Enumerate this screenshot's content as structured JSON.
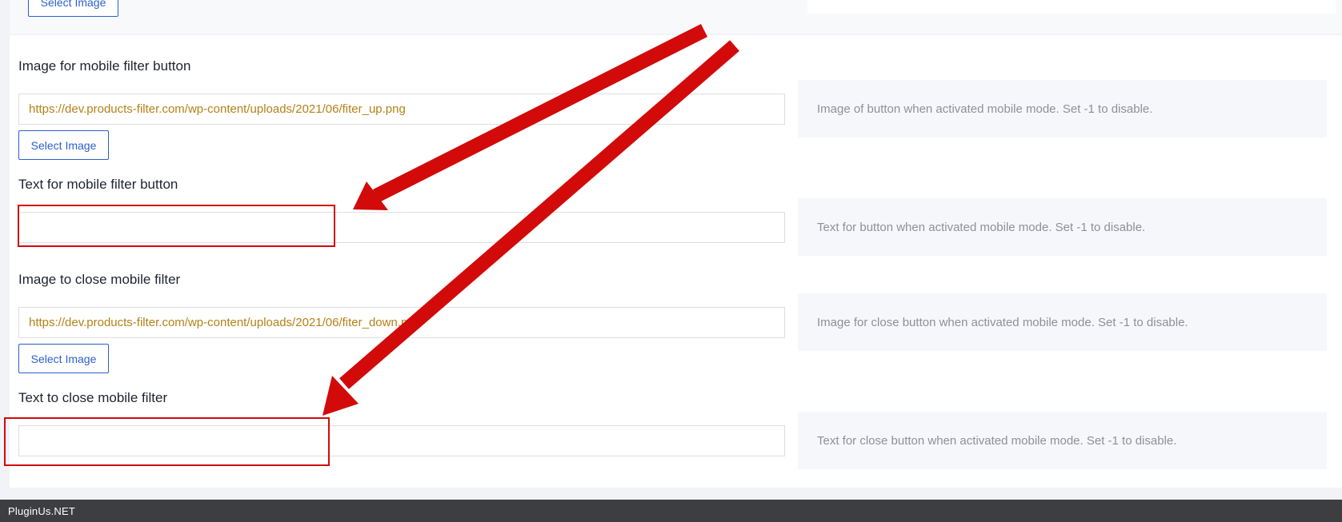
{
  "settings": {
    "top": {
      "select_button_label": "Select Image"
    },
    "options": [
      {
        "label": "Image for mobile filter button",
        "value": "https://dev.products-filter.com/wp-content/uploads/2021/06/fiter_up.png",
        "button_label": "Select Image",
        "note": "Image of button when activated mobile mode. Set -1 to disable."
      },
      {
        "label": "Text for mobile filter button",
        "value": "",
        "note": "Text for button when activated mobile mode. Set -1 to disable."
      },
      {
        "label": "Image to close mobile filter",
        "value": "https://dev.products-filter.com/wp-content/uploads/2021/06/fiter_down.png",
        "button_label": "Select Image",
        "note": "Image for close button when activated mobile mode. Set -1 to disable."
      },
      {
        "label": "Text to close mobile filter",
        "value": "",
        "note": "Text for close button when activated mobile mode. Set -1 to disable."
      }
    ]
  },
  "annotation": {
    "color": "#d20a0a"
  },
  "footer": {
    "brand": "PluginUs.NET"
  }
}
